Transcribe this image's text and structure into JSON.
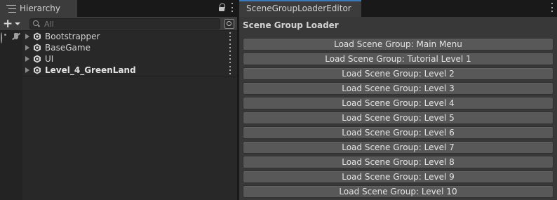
{
  "hierarchy": {
    "tab_title": "Hierarchy",
    "search_placeholder": "All",
    "items": [
      {
        "label": "Bootstrapper",
        "active": false
      },
      {
        "label": "BaseGame",
        "active": false
      },
      {
        "label": "UI",
        "active": false
      },
      {
        "label": "Level_4_GreenLand",
        "active": true
      }
    ]
  },
  "scene_group_loader": {
    "tab_title": "SceneGroupLoaderEditor",
    "section_title": "Scene Group Loader",
    "buttons": [
      "Load Scene Group: Main Menu",
      "Load Scene Group: Tutorial Level 1",
      "Load Scene Group: Level 2",
      "Load Scene Group: Level 3",
      "Load Scene Group: Level 4",
      "Load Scene Group: Level 5",
      "Load Scene Group: Level 6",
      "Load Scene Group: Level 7",
      "Load Scene Group: Level 8",
      "Load Scene Group: Level 9",
      "Load Scene Group: Level 10"
    ]
  },
  "icons": {
    "hierarchy_tab": "hierarchy-list-icon",
    "lock": "lock-icon",
    "menu": "kebab-menu-icon",
    "add": "plus-icon",
    "search": "search-icon",
    "filter": "scene-filter-icon",
    "visibility": "eye-icon",
    "pickability": "hand-icon",
    "scene": "unity-logo-icon",
    "expand": "triangle-right-icon"
  },
  "colors": {
    "panel_bg": "#383838",
    "hierarchy_bg": "#282828",
    "tab_active": "#3c3c3c",
    "tab_accent": "#3a79bb",
    "button_bg": "#585858"
  }
}
